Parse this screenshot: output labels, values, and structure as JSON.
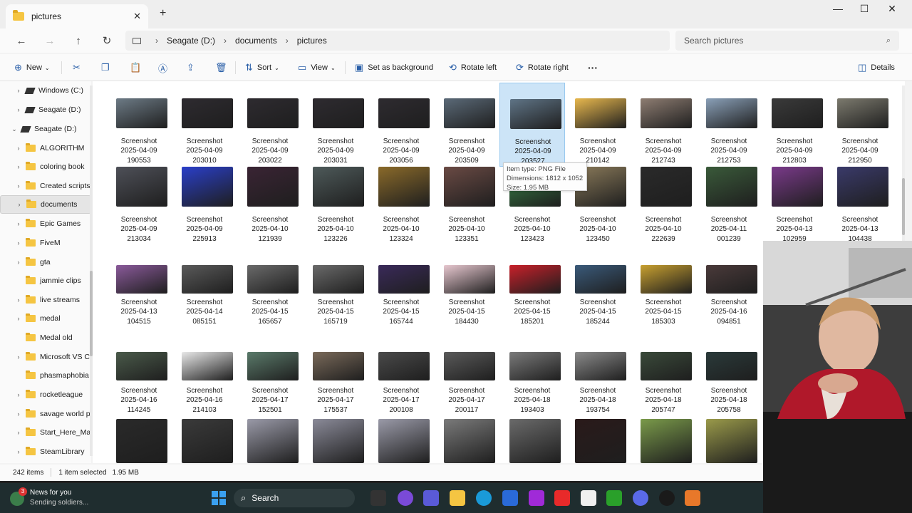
{
  "window": {
    "tab_title": "pictures",
    "new_tab": "+",
    "minimize": "—",
    "maximize": "☐",
    "close": "✕"
  },
  "nav": {
    "back": "←",
    "forward": "→",
    "up": "↑",
    "refresh": "↻",
    "breadcrumb": [
      "Seagate (D:)",
      "documents",
      "pictures"
    ],
    "search_placeholder": "Search pictures"
  },
  "commands": {
    "new": "New",
    "sort": "Sort",
    "view": "View",
    "set_background": "Set as background",
    "rotate_left": "Rotate left",
    "rotate_right": "Rotate right",
    "more": "···",
    "details": "Details"
  },
  "sidebar": {
    "items": [
      {
        "label": "Windows (C:)",
        "type": "drive",
        "expand": "›"
      },
      {
        "label": "Seagate (D:)",
        "type": "drive",
        "expand": "›"
      },
      {
        "label": "Seagate (D:)",
        "type": "drive",
        "expand": "⌄"
      },
      {
        "label": "ALGORITHM",
        "type": "folder",
        "expand": "›"
      },
      {
        "label": "coloring book",
        "type": "folder",
        "expand": "›"
      },
      {
        "label": "Created scripts",
        "type": "folder",
        "expand": "›"
      },
      {
        "label": "documents",
        "type": "folder",
        "expand": "›"
      },
      {
        "label": "Epic Games",
        "type": "folder",
        "expand": "›"
      },
      {
        "label": "FiveM",
        "type": "folder",
        "expand": "›"
      },
      {
        "label": "gta",
        "type": "folder",
        "expand": "›"
      },
      {
        "label": "jammie clips",
        "type": "folder",
        "expand": ""
      },
      {
        "label": "live streams",
        "type": "folder",
        "expand": "›"
      },
      {
        "label": "medal",
        "type": "folder",
        "expand": "›"
      },
      {
        "label": "Medal old",
        "type": "folder",
        "expand": ""
      },
      {
        "label": "Microsoft VS C",
        "type": "folder",
        "expand": "›"
      },
      {
        "label": "phasmaphobia",
        "type": "folder",
        "expand": ""
      },
      {
        "label": "rocketleague",
        "type": "folder",
        "expand": "›"
      },
      {
        "label": "savage world p",
        "type": "folder",
        "expand": "›"
      },
      {
        "label": "Start_Here_Ma",
        "type": "folder",
        "expand": "›"
      },
      {
        "label": "SteamLibrary",
        "type": "folder",
        "expand": "›"
      }
    ]
  },
  "files": [
    [
      {
        "l1": "Screenshot",
        "l2": "2025-04-09",
        "l3": "190553",
        "c": "#6d7b86"
      },
      {
        "l1": "Screenshot",
        "l2": "2025-04-09",
        "l3": "203010",
        "c": "#2e2b30"
      },
      {
        "l1": "Screenshot",
        "l2": "2025-04-09",
        "l3": "203022",
        "c": "#2e2b30"
      },
      {
        "l1": "Screenshot",
        "l2": "2025-04-09",
        "l3": "203031",
        "c": "#2e2b30"
      },
      {
        "l1": "Screenshot",
        "l2": "2025-04-09",
        "l3": "203056",
        "c": "#2e2b30"
      },
      {
        "l1": "Screenshot",
        "l2": "2025-04-09",
        "l3": "203509",
        "c": "#5b6a78"
      },
      {
        "l1": "Screenshot",
        "l2": "2025-04-09",
        "l3": "203527",
        "c": "#5f7486"
      },
      {
        "l1": "Screenshot",
        "l2": "2025-04-09",
        "l3": "210142",
        "c": "#e8b84e"
      },
      {
        "l1": "Screenshot",
        "l2": "2025-04-09",
        "l3": "212743",
        "c": "#8e7d72"
      },
      {
        "l1": "Screenshot",
        "l2": "2025-04-09",
        "l3": "212753",
        "c": "#8aa0b8"
      },
      {
        "l1": "Screenshot",
        "l2": "2025-04-09",
        "l3": "212803",
        "c": "#3a3a3a"
      },
      {
        "l1": "Screenshot",
        "l2": "2025-04-09",
        "l3": "212950",
        "c": "#7c7a6e"
      }
    ],
    [
      {
        "l1": "Screenshot",
        "l2": "2025-04-09",
        "l3": "213034",
        "c": "#4e5058"
      },
      {
        "l1": "Screenshot",
        "l2": "2025-04-09",
        "l3": "225913",
        "c": "#2a3fc9"
      },
      {
        "l1": "Screenshot",
        "l2": "2025-04-10",
        "l3": "121939",
        "c": "#3a2434"
      },
      {
        "l1": "Screenshot",
        "l2": "2025-04-10",
        "l3": "123226",
        "c": "#4e5a5a"
      },
      {
        "l1": "Screenshot",
        "l2": "2025-04-10",
        "l3": "123324",
        "c": "#8a6a2a"
      },
      {
        "l1": "Screenshot",
        "l2": "2025-04-10",
        "l3": "123351",
        "c": "#6a4a44"
      },
      {
        "l1": "Screenshot",
        "l2": "2025-04-10",
        "l3": "123423",
        "c": "#3a8a4a"
      },
      {
        "l1": "Screenshot",
        "l2": "2025-04-10",
        "l3": "123450",
        "c": "#8a7a5a"
      },
      {
        "l1": "Screenshot",
        "l2": "2025-04-10",
        "l3": "222639",
        "c": "#2a2a2a"
      },
      {
        "l1": "Screenshot",
        "l2": "2025-04-11",
        "l3": "001239",
        "c": "#3a5a3a"
      },
      {
        "l1": "Screenshot",
        "l2": "2025-04-13",
        "l3": "102959",
        "c": "#7a3a8a"
      },
      {
        "l1": "Screenshot",
        "l2": "2025-04-13",
        "l3": "104438",
        "c": "#3a3a6a"
      }
    ],
    [
      {
        "l1": "Screenshot",
        "l2": "2025-04-13",
        "l3": "104515",
        "c": "#8a5a9a"
      },
      {
        "l1": "Screenshot",
        "l2": "2025-04-14",
        "l3": "085151",
        "c": "#5a5a5a"
      },
      {
        "l1": "Screenshot",
        "l2": "2025-04-15",
        "l3": "165657",
        "c": "#6a6a6a"
      },
      {
        "l1": "Screenshot",
        "l2": "2025-04-15",
        "l3": "165719",
        "c": "#6a6a6a"
      },
      {
        "l1": "Screenshot",
        "l2": "2025-04-15",
        "l3": "165744",
        "c": "#3a2a5a"
      },
      {
        "l1": "Screenshot",
        "l2": "2025-04-15",
        "l3": "184430",
        "c": "#e8c8d0"
      },
      {
        "l1": "Screenshot",
        "l2": "2025-04-15",
        "l3": "185201",
        "c": "#c8202a"
      },
      {
        "l1": "Screenshot",
        "l2": "2025-04-15",
        "l3": "185244",
        "c": "#3a5a7a"
      },
      {
        "l1": "Screenshot",
        "l2": "2025-04-15",
        "l3": "185303",
        "c": "#c8a030"
      },
      {
        "l1": "Screenshot",
        "l2": "2025-04-16",
        "l3": "094851",
        "c": "#4a3a3a"
      }
    ],
    [
      {
        "l1": "Screenshot",
        "l2": "2025-04-16",
        "l3": "114245",
        "c": "#4a5a4a"
      },
      {
        "l1": "Screenshot",
        "l2": "2025-04-16",
        "l3": "214103",
        "c": "#e8e8e8"
      },
      {
        "l1": "Screenshot",
        "l2": "2025-04-17",
        "l3": "152501",
        "c": "#5a7a6a"
      },
      {
        "l1": "Screenshot",
        "l2": "2025-04-17",
        "l3": "175537",
        "c": "#7a6a5a"
      },
      {
        "l1": "Screenshot",
        "l2": "2025-04-17",
        "l3": "200108",
        "c": "#4a4a4a"
      },
      {
        "l1": "Screenshot",
        "l2": "2025-04-17",
        "l3": "200117",
        "c": "#5a5a5a"
      },
      {
        "l1": "Screenshot",
        "l2": "2025-04-18",
        "l3": "193403",
        "c": "#7a7a7a"
      },
      {
        "l1": "Screenshot",
        "l2": "2025-04-18",
        "l3": "193754",
        "c": "#8a8a8a"
      },
      {
        "l1": "Screenshot",
        "l2": "2025-04-18",
        "l3": "205747",
        "c": "#3a4a3a"
      },
      {
        "l1": "Screenshot",
        "l2": "2025-04-18",
        "l3": "205758",
        "c": "#2a3a3a"
      }
    ],
    [
      {
        "l1": "",
        "l2": "",
        "l3": "",
        "c": "#2a2a2a"
      },
      {
        "l1": "",
        "l2": "",
        "l3": "",
        "c": "#3a3a3a"
      },
      {
        "l1": "",
        "l2": "",
        "l3": "",
        "c": "#9a9aa8"
      },
      {
        "l1": "",
        "l2": "",
        "l3": "",
        "c": "#8a8a98"
      },
      {
        "l1": "",
        "l2": "",
        "l3": "",
        "c": "#9a9aa8"
      },
      {
        "l1": "",
        "l2": "",
        "l3": "",
        "c": "#7a7a7a"
      },
      {
        "l1": "",
        "l2": "",
        "l3": "",
        "c": "#6a6a6a"
      },
      {
        "l1": "",
        "l2": "",
        "l3": "",
        "c": "#2a1a1a"
      },
      {
        "l1": "",
        "l2": "",
        "l3": "",
        "c": "#7a9a4a"
      },
      {
        "l1": "",
        "l2": "",
        "l3": "",
        "c": "#9a9a4a"
      }
    ]
  ],
  "tooltip": {
    "type": "Item type: PNG File",
    "dims": "Dimensions: 1812 x 1052",
    "size": "Size: 1.95 MB"
  },
  "status": {
    "count": "242 items",
    "selected": "1 item selected",
    "size": "1.95 MB"
  },
  "taskbar": {
    "news_title": "News for you",
    "news_sub": "Sending soldiers...",
    "news_badge": "3",
    "search": "Search"
  }
}
